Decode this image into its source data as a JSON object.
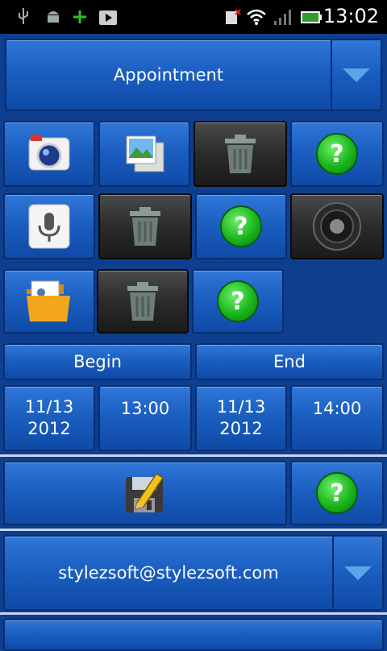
{
  "status_bar": {
    "time": "13:02"
  },
  "header": {
    "title": "Appointment"
  },
  "schedule": {
    "begin_label": "Begin",
    "end_label": "End",
    "begin_date_line1": "11/13",
    "begin_date_line2": "2012",
    "begin_time": "13:00",
    "end_date_line1": "11/13",
    "end_date_line2": "2012",
    "end_time": "14:00"
  },
  "account": {
    "email": "stylezsoft@stylezsoft.com"
  },
  "help_glyph": "?",
  "icons": {
    "camera": "camera-icon",
    "gallery": "gallery-icon",
    "trash": "trash-icon",
    "help": "help-icon",
    "microphone": "microphone-icon",
    "speaker": "speaker-icon",
    "contact_folder": "contact-folder-icon",
    "save": "save-icon",
    "dropdown": "chevron-down-icon"
  },
  "colors": {
    "accent": "#1b5fc1",
    "help": "#19b51c",
    "background": "#0d3f8e"
  }
}
